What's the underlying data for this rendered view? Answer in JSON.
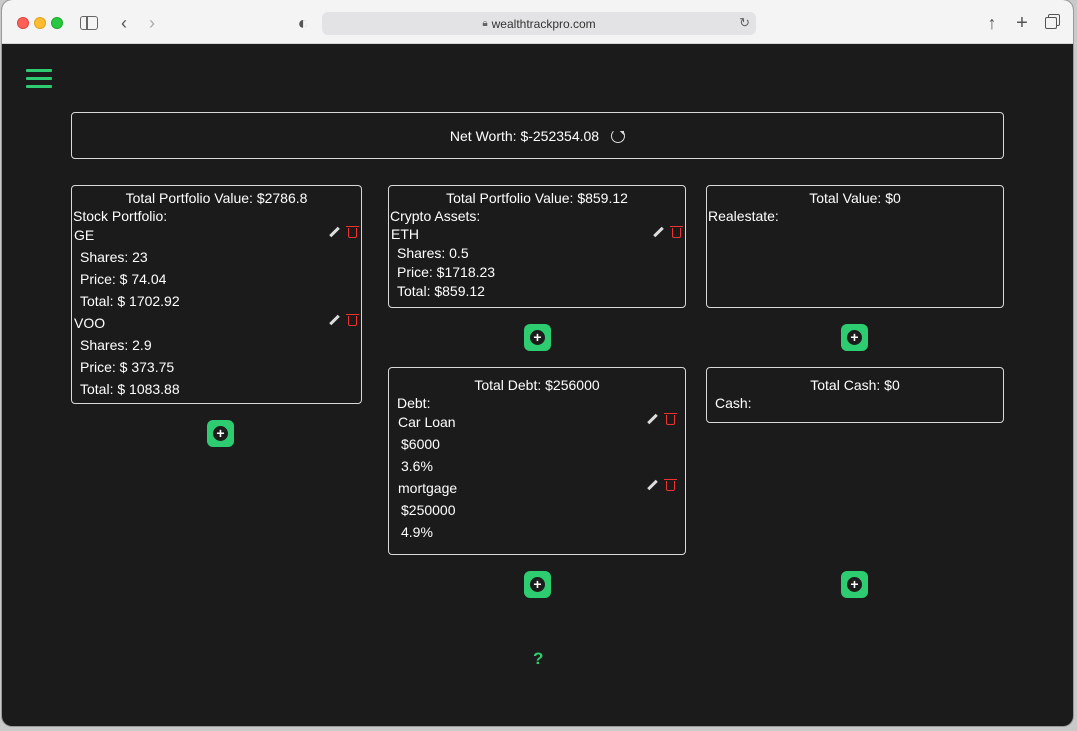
{
  "browser": {
    "url": "wealthtrackpro.com"
  },
  "networth": {
    "label": "Net Worth: $-252354.08"
  },
  "stocks": {
    "title": "Total Portfolio Value: $2786.8",
    "section_label": "Stock Portfolio:",
    "items": [
      {
        "name": "GE",
        "shares": "Shares: 23",
        "price": "Price: $ 74.04",
        "total": "Total: $ 1702.92"
      },
      {
        "name": "VOO",
        "shares": "Shares: 2.9",
        "price": "Price: $ 373.75",
        "total": "Total: $ 1083.88"
      }
    ]
  },
  "crypto": {
    "title": "Total Portfolio Value: $859.12",
    "section_label": "Crypto Assets:",
    "items": [
      {
        "name": "ETH",
        "shares": "Shares: 0.5",
        "price": "Price: $1718.23",
        "total": "Total: $859.12"
      }
    ]
  },
  "realestate": {
    "title": "Total Value: $0",
    "section_label": "Realestate:"
  },
  "debt": {
    "title": "Total Debt: $256000",
    "section_label": "Debt:",
    "items": [
      {
        "name": "Car Loan",
        "amount": "$6000",
        "rate": "3.6%"
      },
      {
        "name": "mortgage",
        "amount": "$250000",
        "rate": "4.9%"
      }
    ]
  },
  "cash": {
    "title": "Total Cash: $0",
    "section_label": "Cash:"
  },
  "buttons": {
    "add_symbol": "+"
  },
  "help": {
    "label": "?"
  },
  "colors": {
    "accent": "#2ecc71",
    "background": "#1b1b1b",
    "delete": "#e33333"
  }
}
